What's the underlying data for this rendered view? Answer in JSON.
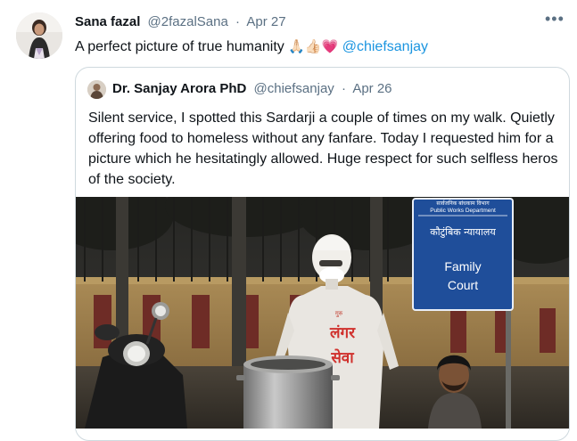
{
  "tweet": {
    "name": "Sana fazal",
    "handle": "@2fazalSana",
    "separator": "·",
    "date": "Apr 27",
    "text": "A perfect picture of true humanity",
    "emojis": "🙏🏻👍🏻💗",
    "mention": "@chiefsanjay",
    "more_label": "•••"
  },
  "quoted": {
    "name": "Dr. Sanjay Arora PhD",
    "handle": "@chiefsanjay",
    "separator": "·",
    "date": "Apr 26",
    "text": "Silent service, I spotted this Sardarji a couple of times on my walk. Quietly offering food to homeless without any fanfare. Today I requested him for a picture which he hesitatingly allowed. Huge respect for such selfless heros of the society."
  },
  "photo": {
    "sign_hindi_top": "सार्वजनिक बांधकाम विभाग",
    "sign_english_top": "Public Works Department",
    "sign_hindi": "कौटुंबिक न्यायालय",
    "sign_english_line1": "Family",
    "sign_english_line2": "Court",
    "shirt_small": "गुरु",
    "shirt_line1": "लंगर",
    "shirt_line2": "सेवा"
  }
}
